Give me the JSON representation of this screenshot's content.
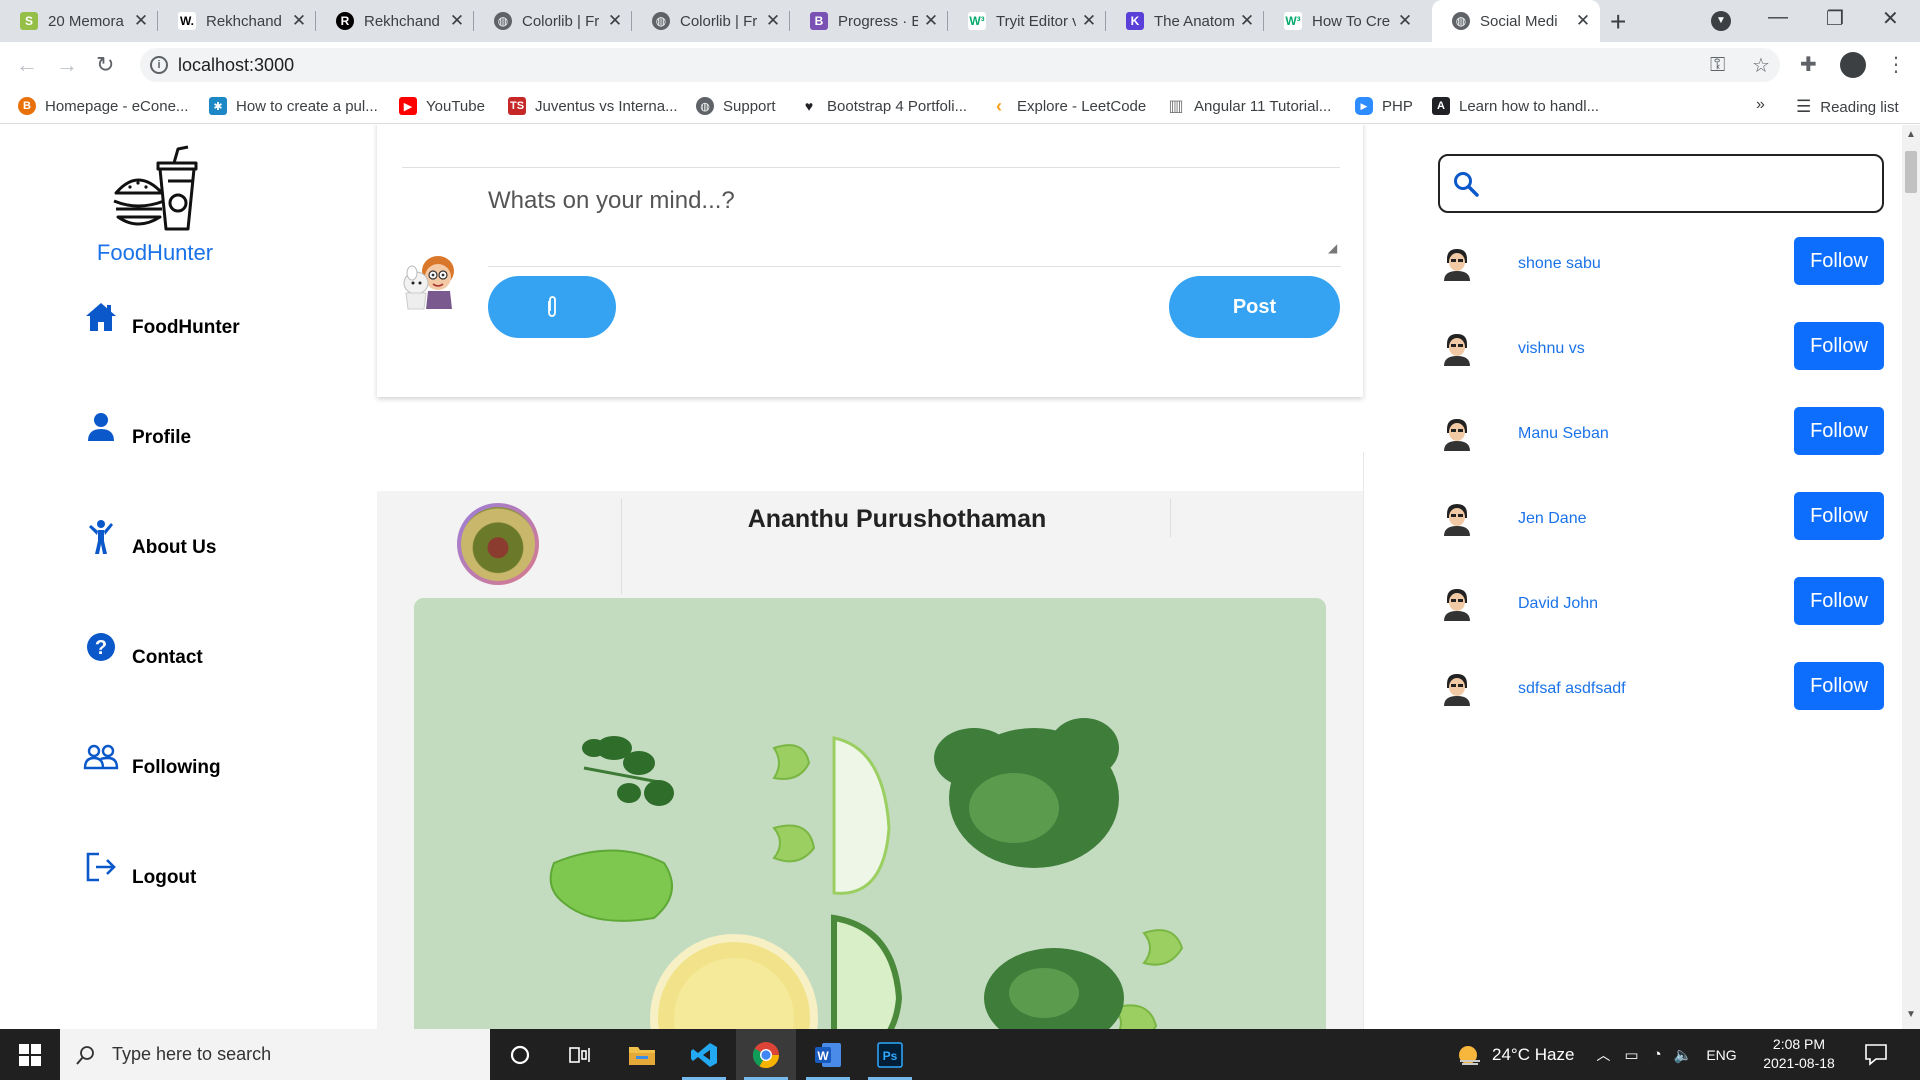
{
  "browser": {
    "tabs": [
      {
        "title": "20 Memora",
        "favicon": "shopify-icon",
        "color": "#95bf47"
      },
      {
        "title": "Rekhchand",
        "favicon": "w-icon",
        "color": "#000000"
      },
      {
        "title": "Rekhchand",
        "favicon": "r-icon",
        "color": "#000000"
      },
      {
        "title": "Colorlib | Fr",
        "favicon": "globe-icon",
        "color": "#5f6368"
      },
      {
        "title": "Colorlib | Fr",
        "favicon": "globe-icon",
        "color": "#5f6368"
      },
      {
        "title": "Progress · B",
        "favicon": "bootstrap-icon",
        "color": "#7952b3"
      },
      {
        "title": "Tryit Editor v",
        "favicon": "w3-icon",
        "color": "#04aa6d"
      },
      {
        "title": "The Anatom",
        "favicon": "k-icon",
        "color": "#5b3fd9"
      },
      {
        "title": "How To Cre",
        "favicon": "w3-icon",
        "color": "#04aa6d"
      },
      {
        "title": "Social Medi",
        "favicon": "globe-icon",
        "color": "#5f6368",
        "active": true
      }
    ],
    "url": "localhost:3000",
    "bookmarks": [
      {
        "label": "Homepage - eCone...",
        "color": "#e8710a",
        "glyph": "B"
      },
      {
        "label": "How to create a pul...",
        "color": "#1e88c6",
        "glyph": "✱"
      },
      {
        "label": "YouTube",
        "color": "#ff0000",
        "glyph": "▶"
      },
      {
        "label": "Juventus vs Interna...",
        "color": "#c62828",
        "glyph": "TS"
      },
      {
        "label": "Support",
        "color": "#5f6368",
        "glyph": "◍"
      },
      {
        "label": "Bootstrap 4 Portfoli...",
        "color": "#202124",
        "glyph": "♥"
      },
      {
        "label": "Explore - LeetCode",
        "color": "#f89f1b",
        "glyph": "‹"
      },
      {
        "label": "Angular 11 Tutorial...",
        "color": "#757575",
        "glyph": "▥"
      },
      {
        "label": "PHP",
        "color": "#2d8cff",
        "glyph": "▶"
      },
      {
        "label": "Learn how to handl...",
        "color": "#202124",
        "glyph": "A"
      }
    ],
    "more_label": "»",
    "reading_list_label": "Reading list"
  },
  "sidebar": {
    "brand_name": "FoodHunter",
    "items": [
      {
        "label": "FoodHunter",
        "icon": "home-icon"
      },
      {
        "label": "Profile",
        "icon": "user-icon"
      },
      {
        "label": "About Us",
        "icon": "person-walking-icon"
      },
      {
        "label": "Contact",
        "icon": "question-circle-icon"
      },
      {
        "label": "Following",
        "icon": "users-icon"
      },
      {
        "label": "Logout",
        "icon": "logout-icon"
      }
    ]
  },
  "composer": {
    "placeholder": "Whats on your mind...?",
    "attach_icon": "paperclip-icon",
    "post_label": "Post"
  },
  "post": {
    "author": "Ananthu Purushothaman"
  },
  "right_panel": {
    "search_placeholder": "",
    "follow_label": "Follow",
    "users": [
      {
        "name": "shone sabu"
      },
      {
        "name": "vishnu vs"
      },
      {
        "name": "Manu Seban"
      },
      {
        "name": "Jen Dane"
      },
      {
        "name": "David John"
      },
      {
        "name": "sdfsaf asdfsadf"
      }
    ]
  },
  "taskbar": {
    "search_placeholder": "Type here to search",
    "weather": "24°C  Haze",
    "language": "ENG",
    "time": "2:08 PM",
    "date": "2021-08-18"
  },
  "colors": {
    "accent_blue": "#0d6efd",
    "post_button": "#35a3f2",
    "link_blue": "#1a73e8"
  }
}
